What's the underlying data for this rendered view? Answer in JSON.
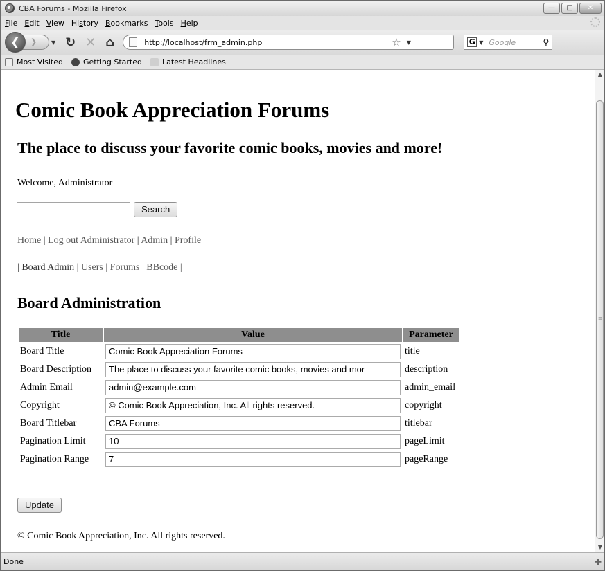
{
  "browser": {
    "window_title": "CBA Forums - Mozilla Firefox",
    "menu": [
      {
        "accel": "F",
        "rest": "ile"
      },
      {
        "accel": "E",
        "rest": "dit"
      },
      {
        "accel": "V",
        "rest": "iew"
      },
      {
        "pre": "Hi",
        "accel": "s",
        "rest": "tory"
      },
      {
        "accel": "B",
        "rest": "ookmarks"
      },
      {
        "accel": "T",
        "rest": "ools"
      },
      {
        "accel": "H",
        "rest": "elp"
      }
    ],
    "url": "http://localhost/frm_admin.php",
    "search_placeholder": "Google",
    "bookmarks": [
      "Most Visited",
      "Getting Started",
      "Latest Headlines"
    ],
    "status": "Done"
  },
  "page": {
    "title": "Comic Book Appreciation Forums",
    "description": "The place to discuss your favorite comic books, movies and more!",
    "welcome": "Welcome, Administrator",
    "search_button": "Search",
    "nav": [
      "Home",
      "Log out Administrator",
      "Admin",
      "Profile"
    ],
    "admin_nav": {
      "current": "Board Admin",
      "links": [
        "Users",
        "Forums",
        "BBcode"
      ]
    },
    "section_title": "Board Administration",
    "table": {
      "headers": [
        "Title",
        "Value",
        "Parameter"
      ],
      "rows": [
        {
          "title": "Board Title",
          "value": "Comic Book Appreciation Forums",
          "param": "title"
        },
        {
          "title": "Board Description",
          "value": "The place to discuss your favorite comic books, movies and mor",
          "param": "description"
        },
        {
          "title": "Admin Email",
          "value": "admin@example.com",
          "param": "admin_email"
        },
        {
          "title": "Copyright",
          "value": "© Comic Book Appreciation, Inc.  All rights reserved.",
          "param": "copyright"
        },
        {
          "title": "Board Titlebar",
          "value": "CBA Forums",
          "param": "titlebar"
        },
        {
          "title": "Pagination Limit",
          "value": "10",
          "param": "pageLimit"
        },
        {
          "title": "Pagination Range",
          "value": "7",
          "param": "pageRange"
        }
      ]
    },
    "update_button": "Update",
    "footer": "© Comic Book Appreciation, Inc. All rights reserved."
  }
}
